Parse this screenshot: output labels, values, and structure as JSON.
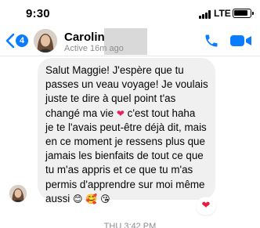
{
  "status_bar": {
    "time": "9:30",
    "carrier": "LTE",
    "icons": [
      "signal-bars-icon",
      "battery-icon"
    ]
  },
  "header": {
    "unread_count": "4",
    "contact_name": "Caroline",
    "contact_status": "Active 16m ago",
    "icons": [
      "back-chevron-icon",
      "phone-icon",
      "video-camera-icon"
    ],
    "accent_color": "#0a7cff"
  },
  "message": {
    "lines": [
      "Salut Maggie! J'espère que tu",
      "passes un veau voyage! Je voulais",
      "juste te dire à quel point t'as",
      "changé ma vie",
      "c'est tout haha",
      "je te l'avais peut-être déjà dit, mais",
      "en ce moment je ressens plus que",
      "jamais les bienfaits de tout ce que",
      "tu m'as appris et ce que tu m'as",
      "permis d'apprendre sur moi même",
      "aussi"
    ],
    "inline_emoji_heart": "❤",
    "trailing_emojis": "😊 🥰 😘",
    "bubble_color": "#f0f0f0"
  },
  "reaction": {
    "emoji": "❤",
    "color": "#e41e3f"
  },
  "timestamp": "THU 3:42 PM"
}
